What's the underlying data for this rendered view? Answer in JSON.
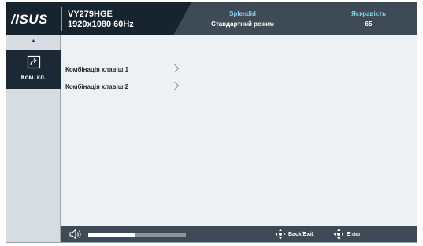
{
  "header": {
    "brand": "ASUS",
    "model": "VY279HGE",
    "resolution": "1920x1080 60Hz",
    "splendid_label": "Splendid",
    "splendid_value": "Стандартний режим",
    "brightness_label": "Яскравість",
    "brightness_value": "65"
  },
  "sidebar": {
    "up_icon": "triangle-up-icon",
    "items": [
      {
        "label": "Ком. кл.",
        "icon": "shortcut-arrow-icon",
        "selected": true
      }
    ]
  },
  "menu": {
    "items": [
      {
        "label": "Комбінація клавіш 1"
      },
      {
        "label": "Комбінація клавіш 2"
      }
    ]
  },
  "footer": {
    "volume_icon": "speaker-icon",
    "volume_level": 0.48,
    "back_label": "Back/Exit",
    "enter_label": "Enter",
    "nav_icon": "joystick-icon"
  },
  "colors": {
    "header_dark": "#17232e",
    "header_mid": "#3e4a55",
    "accent_label": "#8fd0ef",
    "panel": "#eef1f4",
    "sidebar": "#d6dce2"
  }
}
